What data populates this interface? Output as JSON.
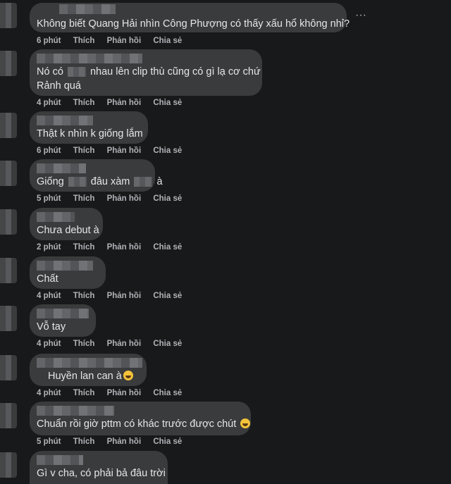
{
  "comments": [
    {
      "text_lines": [
        "Không biết Quang Hải nhìn Công Phượng có thấy xấu hổ không nhỉ?"
      ],
      "time": "6 phút"
    },
    {
      "text_lines": [
        "Nó có",
        "nhau lên clip thù cũng có gì lạ cơ chứ",
        "Rảnh quá"
      ],
      "time": "4 phút"
    },
    {
      "text_lines": [
        "Thật k nhìn k giống lắm"
      ],
      "time": "6 phút"
    },
    {
      "text_lines": [
        "Giống",
        "đâu xàm",
        "à"
      ],
      "time": "5 phút"
    },
    {
      "text_lines": [
        "Chưa debut à"
      ],
      "time": "2 phút"
    },
    {
      "text_lines": [
        "Chất"
      ],
      "time": "4 phút"
    },
    {
      "text_lines": [
        "Vỗ tay"
      ],
      "time": "4 phút"
    },
    {
      "text_lines": [
        "Huyền lan can à"
      ],
      "time": "4 phút"
    },
    {
      "text_lines": [
        "Chuẩn rồi giờ pttm có khác trước được chút"
      ],
      "time": "5 phút"
    },
    {
      "text_lines": [
        "Gì v cha, có phải bả đâu trời"
      ],
      "time": ""
    }
  ],
  "actions": {
    "like": "Thích",
    "reply": "Phản hồi",
    "share": "Chia sẻ"
  },
  "more_icon": "···",
  "icons": {
    "more": "more-options-icon",
    "emoji_laugh": "laughing-emoji-icon"
  },
  "colors": {
    "background": "#18191a",
    "bubble": "#3a3b3c",
    "text": "#e4e6eb",
    "meta": "#b0b3b8"
  }
}
